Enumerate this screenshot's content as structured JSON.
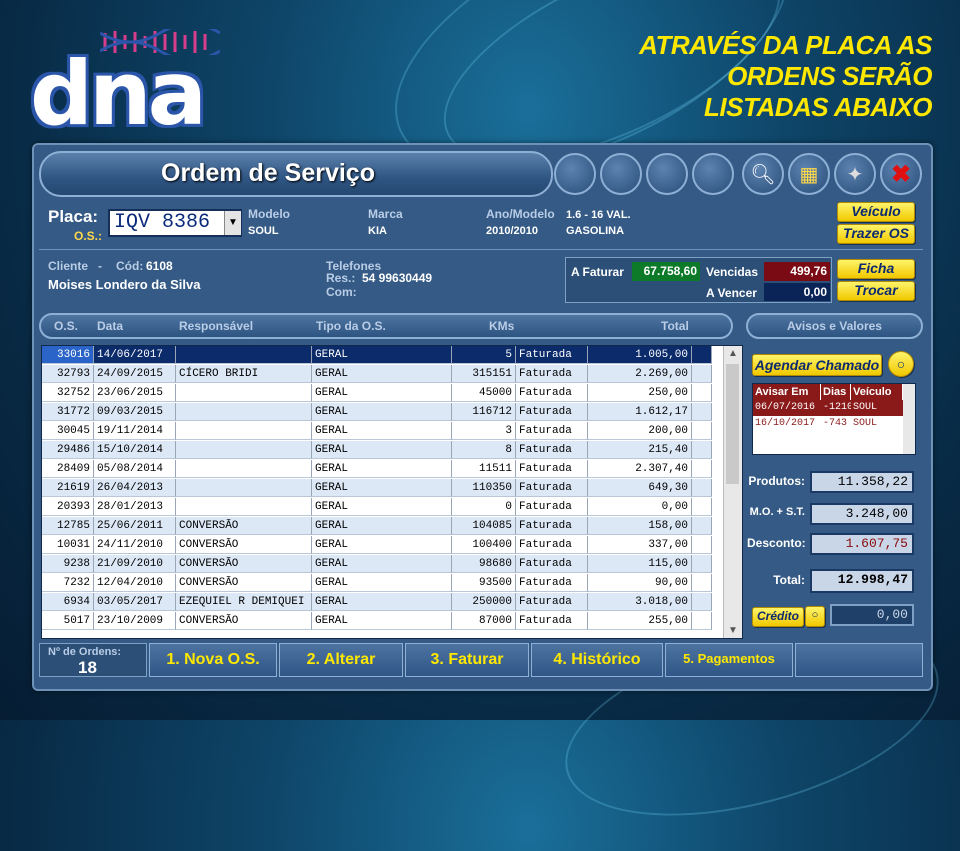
{
  "logo": {
    "text": "dna"
  },
  "headline": [
    "ATRAVÉS DA PLACA AS",
    "ORDENS SERÃO",
    "LISTADAS ABAIXO"
  ],
  "window": {
    "title": "Ordem de Serviço"
  },
  "vehicle": {
    "placa_label": "Placa:",
    "os_label": "O.S.:",
    "placa_value": "IQV 8386",
    "modelo_label": "Modelo",
    "modelo_value": "SOUL",
    "marca_label": "Marca",
    "marca_value": "KIA",
    "ano_label": "Ano/Modelo",
    "ano_value": "2010/2010",
    "motor_value": "1.6 - 16 VAL.",
    "combustivel_value": "GASOLINA",
    "veiculo_btn": "Veículo",
    "trazer_btn": "Trazer OS"
  },
  "cliente": {
    "label": "Cliente",
    "cod_label": "Cód:",
    "cod": "6108",
    "nome": "Moises Londero da Silva",
    "telefones_label": "Telefones",
    "res_label": "Res.:",
    "res": "54 99630449",
    "com_label": "Com:"
  },
  "financeiro": {
    "a_faturar_label": "A Faturar",
    "a_faturar": "67.758,60",
    "vencidas_label": "Vencidas",
    "vencidas": "499,76",
    "a_vencer_label": "A Vencer",
    "a_vencer": "0,00",
    "ficha_btn": "Ficha",
    "trocar_btn": "Trocar"
  },
  "table": {
    "headers": [
      "O.S.",
      "Data",
      "Responsável",
      "Tipo da O.S.",
      "KMs",
      "Total"
    ],
    "rows": [
      [
        "33016",
        "14/06/2017",
        "",
        "GERAL",
        "5",
        "Faturada",
        "1.005,00"
      ],
      [
        "32793",
        "24/09/2015",
        "CÍCERO BRIDI",
        "GERAL",
        "315151",
        "Faturada",
        "2.269,00"
      ],
      [
        "32752",
        "23/06/2015",
        "",
        "GERAL",
        "45000",
        "Faturada",
        "250,00"
      ],
      [
        "31772",
        "09/03/2015",
        "",
        "GERAL",
        "116712",
        "Faturada",
        "1.612,17"
      ],
      [
        "30045",
        "19/11/2014",
        "",
        "GERAL",
        "3",
        "Faturada",
        "200,00"
      ],
      [
        "29486",
        "15/10/2014",
        "",
        "GERAL",
        "8",
        "Faturada",
        "215,40"
      ],
      [
        "28409",
        "05/08/2014",
        "",
        "GERAL",
        "11511",
        "Faturada",
        "2.307,40"
      ],
      [
        "21619",
        "26/04/2013",
        "",
        "GERAL",
        "110350",
        "Faturada",
        "649,30"
      ],
      [
        "20393",
        "28/01/2013",
        "",
        "GERAL",
        "0",
        "Faturada",
        "0,00"
      ],
      [
        "12785",
        "25/06/2011",
        "CONVERSÃO",
        "GERAL",
        "104085",
        "Faturada",
        "158,00"
      ],
      [
        "10031",
        "24/11/2010",
        "CONVERSÃO",
        "GERAL",
        "100400",
        "Faturada",
        "337,00"
      ],
      [
        "9238",
        "21/09/2010",
        "CONVERSÃO",
        "GERAL",
        "98680",
        "Faturada",
        "115,00"
      ],
      [
        "7232",
        "12/04/2010",
        "CONVERSÃO",
        "GERAL",
        "93500",
        "Faturada",
        "90,00"
      ],
      [
        "6934",
        "03/05/2017",
        "EZEQUIEL R DEMIQUEI",
        "GERAL",
        "250000",
        "Faturada",
        "3.018,00"
      ],
      [
        "5017",
        "23/10/2009",
        "CONVERSÃO",
        "GERAL",
        "87000",
        "Faturada",
        "255,00"
      ]
    ]
  },
  "avisos": {
    "header": "Avisos e Valores",
    "agendar_btn": "Agendar Chamado",
    "cols": [
      "Avisar Em",
      "Dias",
      "Veículo"
    ],
    "rows": [
      [
        "06/07/2016",
        "-1210",
        "SOUL"
      ],
      [
        "16/10/2017",
        "-743",
        "SOUL"
      ]
    ]
  },
  "totais": {
    "produtos_label": "Produtos:",
    "produtos": "11.358,22",
    "mo_label": "M.O. + S.T.",
    "mo": "3.248,00",
    "desconto_label": "Desconto:",
    "desconto": "1.607,75",
    "total_label": "Total:",
    "total": "12.998,47",
    "credito_btn": "Crédito",
    "credito": "0,00"
  },
  "footer": {
    "n_ordens_label": "Nº de Ordens:",
    "n_ordens": "18",
    "buttons": [
      "1. Nova O.S.",
      "2. Alterar",
      "3. Faturar",
      "4. Histórico",
      "5. Pagamentos"
    ]
  },
  "colors": {
    "accent_yellow": "#ffe800",
    "window_blue": "#345a85",
    "selected_row": "#0b2b6b",
    "alt_row": "#dce8f6"
  }
}
